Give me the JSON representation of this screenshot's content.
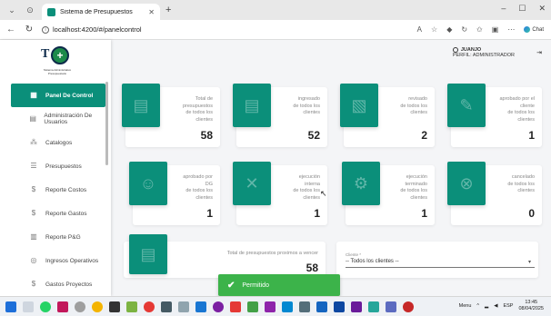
{
  "browser": {
    "tab_title": "Sistema de Presupuestos",
    "url": "localhost:4200/#/panelcontrol",
    "chat_label": "Chat"
  },
  "header": {
    "user_name": "JUANJO",
    "user_role": "PERFIL: ADMINISTRADOR"
  },
  "sidebar": {
    "logo_sub": "Sistema Administrativo Presupuestario",
    "items": [
      {
        "label": "Panel De Control",
        "icon": "dashboard-icon",
        "active": true
      },
      {
        "label": "Administración De Usuarios",
        "icon": "users-icon"
      },
      {
        "label": "Catalogos",
        "icon": "catalog-icon"
      },
      {
        "label": "Presupuestos",
        "icon": "list-icon"
      },
      {
        "label": "Reporte Costos",
        "icon": "dollar-icon"
      },
      {
        "label": "Reporte Gastos",
        "icon": "dollar-icon"
      },
      {
        "label": "Reporte P&G",
        "icon": "report-icon"
      },
      {
        "label": "Ingresos Operativos",
        "icon": "income-icon"
      },
      {
        "label": "Gastos Proyectos",
        "icon": "dollar-icon"
      }
    ]
  },
  "cards": [
    {
      "label_lines": [
        "Total de",
        "presupuestos",
        "de todos los",
        "clientes"
      ],
      "value": "58",
      "icon": "document-icon"
    },
    {
      "label_lines": [
        "ingresado",
        "de todos los",
        "clientes"
      ],
      "value": "52",
      "icon": "document-icon"
    },
    {
      "label_lines": [
        "revisado",
        "de todos los",
        "clientes"
      ],
      "value": "2",
      "icon": "review-icon"
    },
    {
      "label_lines": [
        "aprobado por el",
        "cliente",
        "de todos los",
        "clientes"
      ],
      "value": "1",
      "icon": "approve-icon"
    },
    {
      "label_lines": [
        "aprobado por",
        "DG",
        "de todos los",
        "clientes"
      ],
      "value": "1",
      "icon": "user-approve-icon"
    },
    {
      "label_lines": [
        "ejecución",
        "interna",
        "de todos los",
        "clientes"
      ],
      "value": "1",
      "icon": "tools-icon"
    },
    {
      "label_lines": [
        "ejecución",
        "terminado",
        "de todos los",
        "clientes"
      ],
      "value": "1",
      "icon": "gear-icon"
    },
    {
      "label_lines": [
        "cancelado",
        "de todos los",
        "clientes"
      ],
      "value": "0",
      "icon": "cancel-icon"
    }
  ],
  "summary": {
    "label": "Total de presupuestos proximos a vencer",
    "value": "58"
  },
  "filter": {
    "label": "Cliente *",
    "value": "-- Todos los clientes --"
  },
  "toast": {
    "message": "Permitido"
  },
  "taskbar": {
    "lang": "ESP",
    "time": "13:45",
    "date": "08/04/2025",
    "weather": "Menu"
  },
  "colors": {
    "accent": "#0b8f7a",
    "toast": "#3cb34a"
  }
}
